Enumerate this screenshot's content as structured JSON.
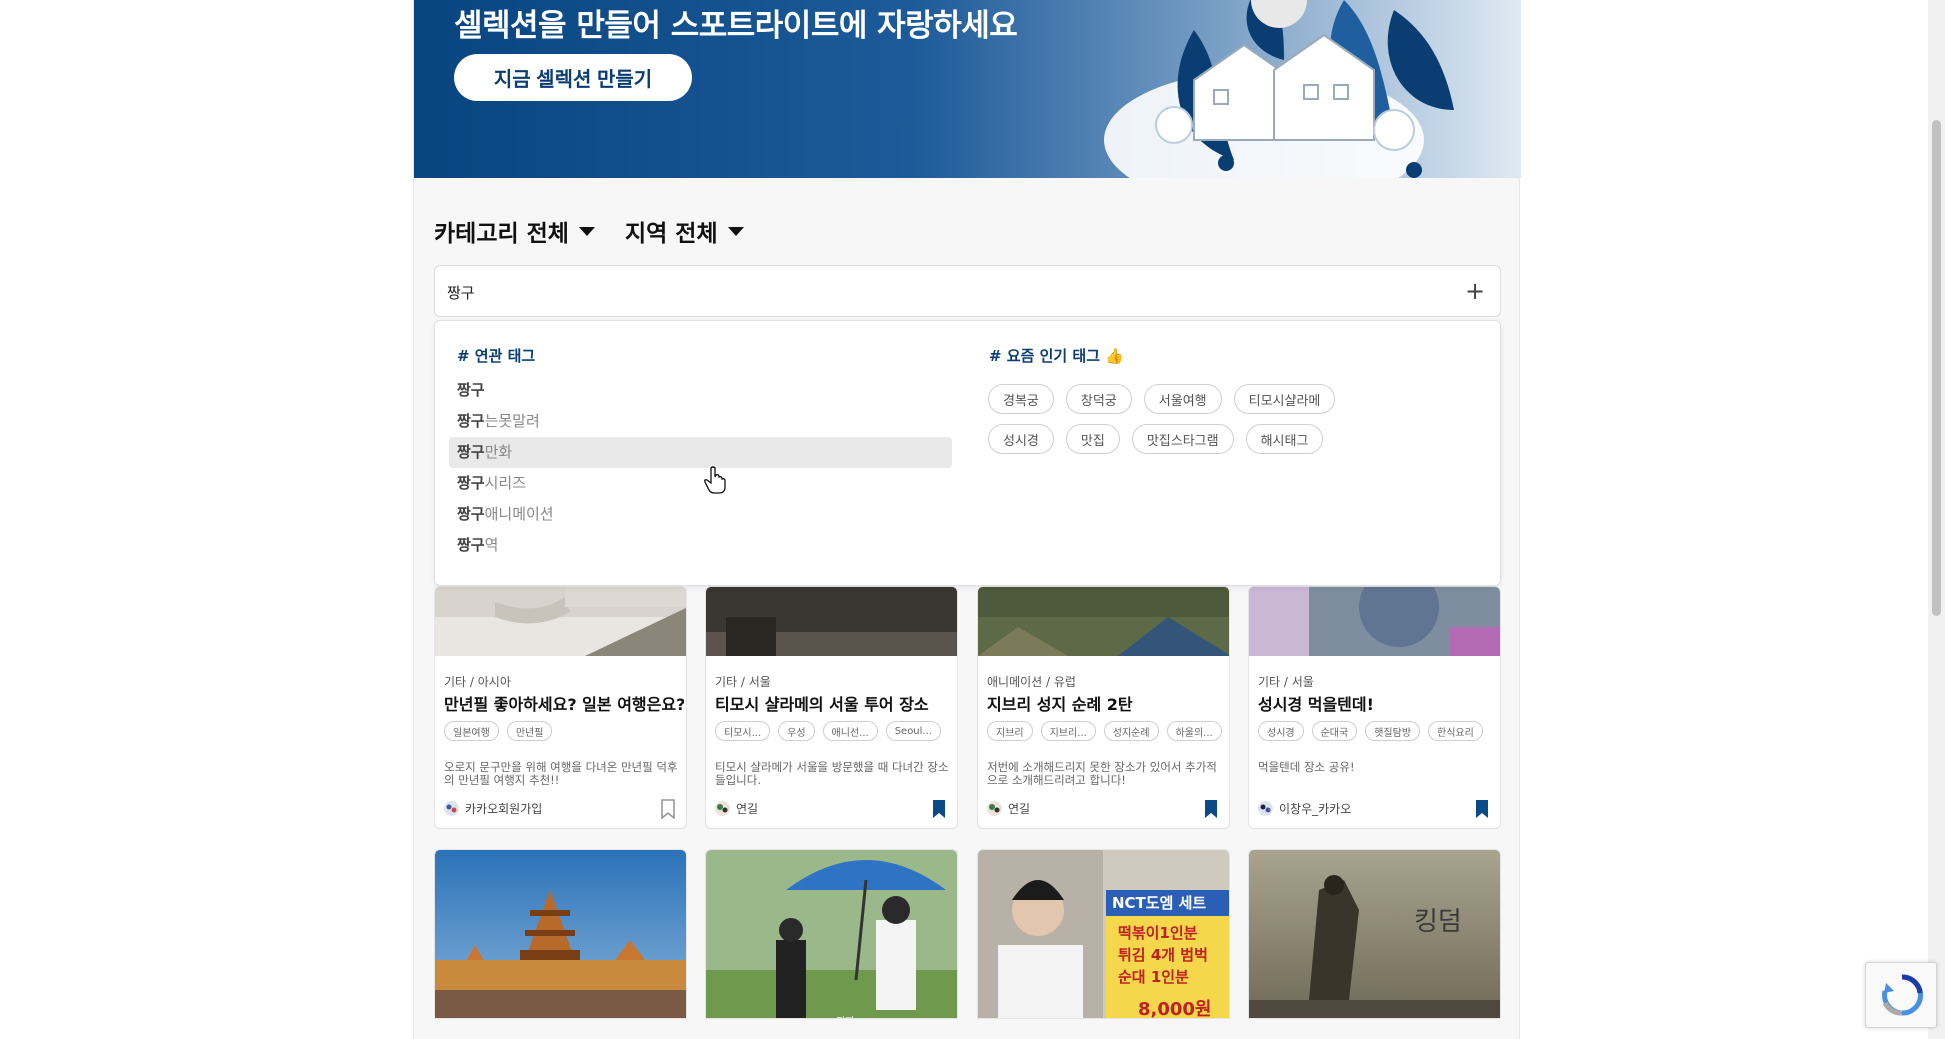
{
  "hero": {
    "title": "셀렉션을 만들어 스포트라이트에 자랑하세요",
    "button_label": "지금 셀렉션 만들기"
  },
  "filters": {
    "category_label": "카테고리 전체",
    "region_label": "지역 전체"
  },
  "tag_input": {
    "value": "짱구",
    "add_icon": "plus-icon"
  },
  "dropdown": {
    "related_title": "# 연관 태그",
    "related": [
      {
        "match": "짱구",
        "rest": ""
      },
      {
        "match": "짱구",
        "rest": "는못말려"
      },
      {
        "match": "짱구",
        "rest": "만화"
      },
      {
        "match": "짱구",
        "rest": "시리즈"
      },
      {
        "match": "짱구",
        "rest": "애니메이션"
      },
      {
        "match": "짱구",
        "rest": "역"
      }
    ],
    "popular_title": "# 요즘 인기 태그 👍",
    "popular": [
      "경복궁",
      "창덕궁",
      "서울여행",
      "티모시샬라메",
      "성시경",
      "맛집",
      "맛집스타그램",
      "해시태그"
    ]
  },
  "cards": [
    {
      "category": "기타 / 아시아",
      "title": "만년필 좋아하세요? 일본 여행은요?",
      "tags": [
        "일본여행",
        "만년필"
      ],
      "description": "오로지 문구만을 위해 여행을 다녀온 만년필 덕후의 만년필 여행지 추천!!",
      "author": "카카오회원가입",
      "bookmarked": false
    },
    {
      "category": "기타 / 서울",
      "title": "티모시 샬라메의 서울 투어 장소",
      "tags": [
        "티모시...",
        "우성",
        "애니선...",
        "Seoul..."
      ],
      "description": "티모시 샬라메가 서울을 방문했을 때 다녀간 장소들입니다.",
      "author": "연길",
      "bookmarked": true
    },
    {
      "category": "애니메이션 / 유럽",
      "title": "지브리 성지 순례 2탄",
      "tags": [
        "지브리",
        "지브리...",
        "성지순례",
        "하울의..."
      ],
      "description": "저번에 소개해드리지 못한 장소가 있어서 추가적으로 소개해드리려고 합니다!",
      "author": "연길",
      "bookmarked": true
    },
    {
      "category": "기타 / 서울",
      "title": "성시경 먹을텐데!",
      "tags": [
        "성시경",
        "순대국",
        "햇질탐방",
        "한식요리"
      ],
      "description": "먹을텐데 장소 공유!",
      "author": "이창우_카카오",
      "bookmarked": true
    }
  ],
  "photo_cards": [
    {
      "caption": ""
    },
    {
      "caption": "진짜"
    },
    {
      "caption": "NCT도엠 세트 떡볶이1인분 튀김 4개 범벅 순대 1인분 8,000원"
    },
    {
      "caption": "킹덤"
    }
  ],
  "colors": {
    "brand_blue": "#0b3f73",
    "bookmark_blue": "#0a4a86"
  }
}
